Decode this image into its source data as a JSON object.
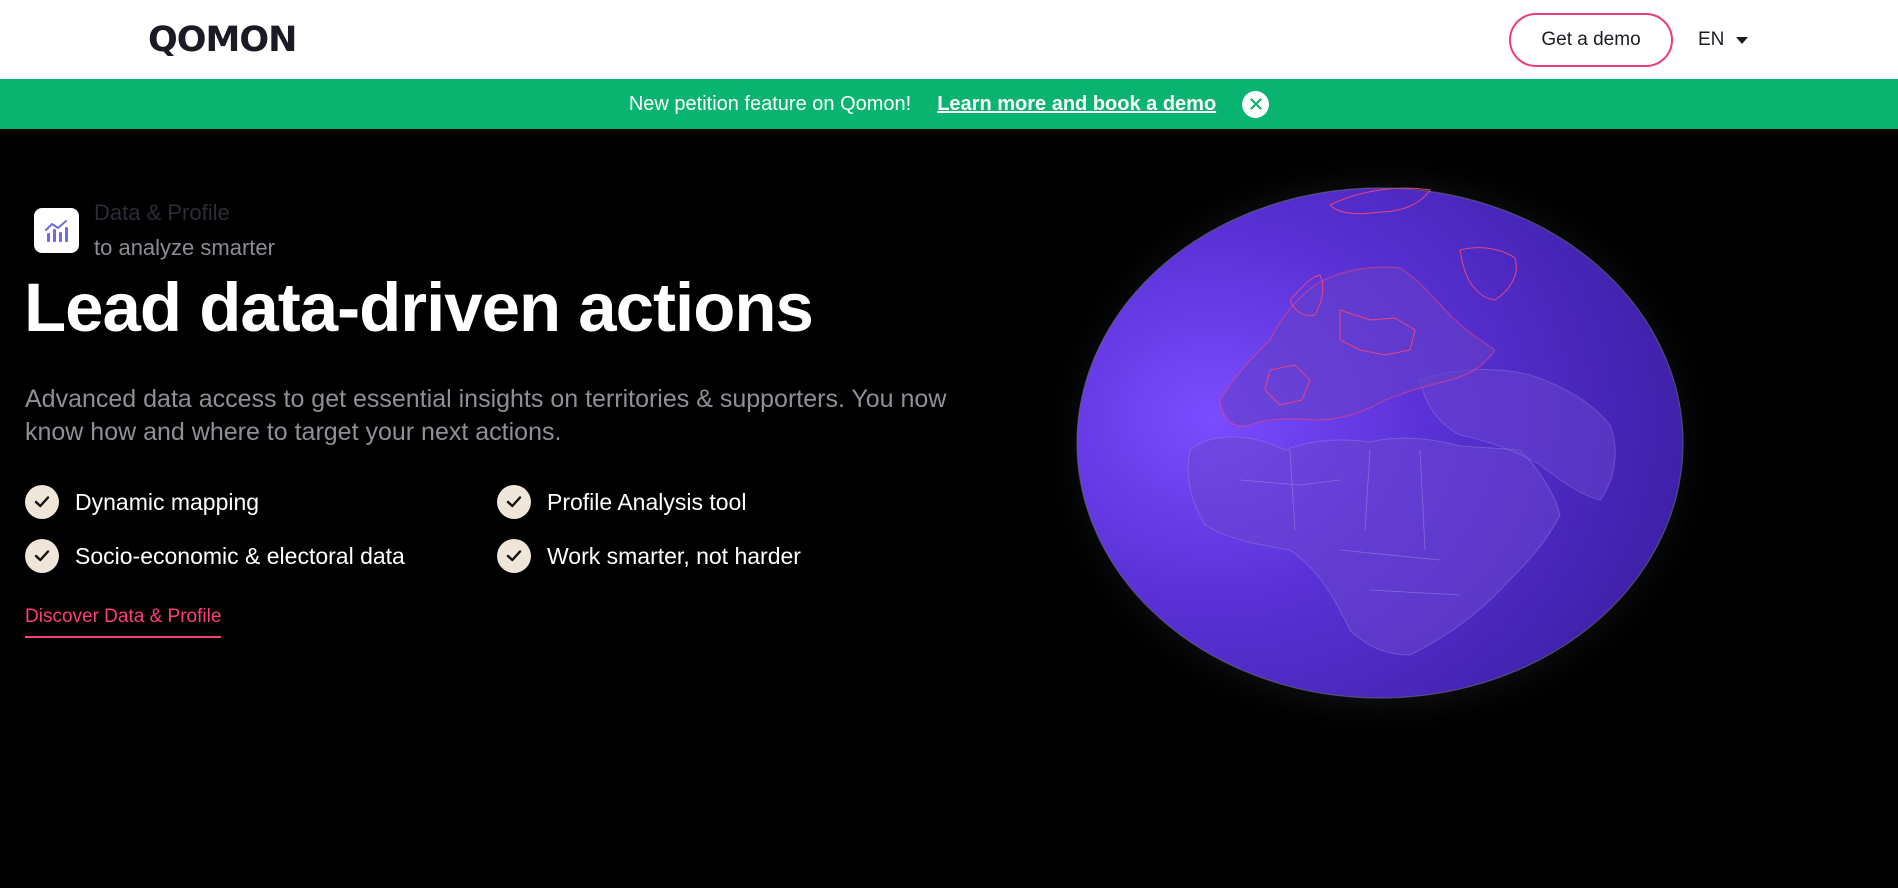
{
  "header": {
    "logo_text": "QOMON",
    "cta_label": "Get a demo",
    "language": "EN"
  },
  "banner": {
    "text": "New petition feature on Qomon!",
    "link_label": "Learn more and book a demo"
  },
  "hero": {
    "eyebrow": "Data & Profile",
    "subeyebrow": "to analyze smarter",
    "title": "Lead data-driven actions",
    "description": "Advanced data access to get essential insights on territories & supporters. You now know how and where to target your next actions.",
    "features": [
      "Dynamic mapping",
      "Profile Analysis tool",
      "Socio-economic & electoral data",
      "Work smarter, not harder"
    ],
    "link_label": "Discover Data & Profile"
  },
  "colors": {
    "brand_green": "#08b470",
    "accent_pink": "#ff3d7f",
    "globe_purple": "#5b2fd0",
    "check_bg": "#efe5d9"
  },
  "icons": [
    "chart-icon",
    "check-icon",
    "close-icon",
    "caret-down-icon",
    "globe-icon"
  ]
}
